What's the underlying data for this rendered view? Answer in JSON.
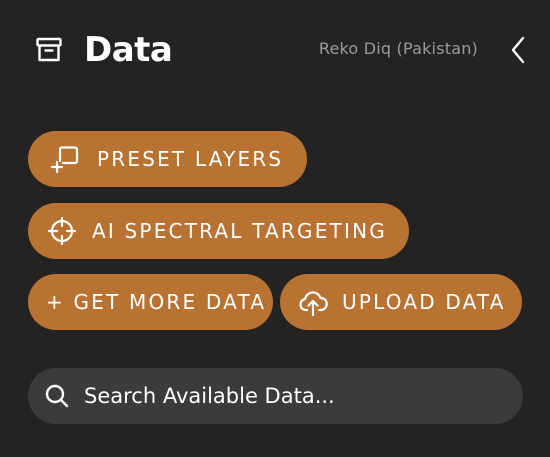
{
  "header": {
    "title": "Data",
    "location": "Reko Diq (Pakistan)",
    "icon": "archive-icon",
    "back_icon": "chevron-left-icon"
  },
  "actions": {
    "preset_layers": {
      "label": "PRESET LAYERS",
      "icon": "layers-add-icon"
    },
    "ai_spectral_targeting": {
      "label": "AI SPECTRAL TARGETING",
      "icon": "crosshair-icon"
    },
    "get_more_data": {
      "label": "+ GET MORE DATA"
    },
    "upload_data": {
      "label": "UPLOAD DATA",
      "icon": "cloud-upload-icon"
    }
  },
  "search": {
    "placeholder": "Search Available Data...",
    "value": "",
    "icon": "search-icon"
  },
  "colors": {
    "background": "#252322",
    "accent": "#b87332",
    "search_background": "#3c3a3b",
    "muted_text": "#9c9a98",
    "text": "#ffffff"
  }
}
